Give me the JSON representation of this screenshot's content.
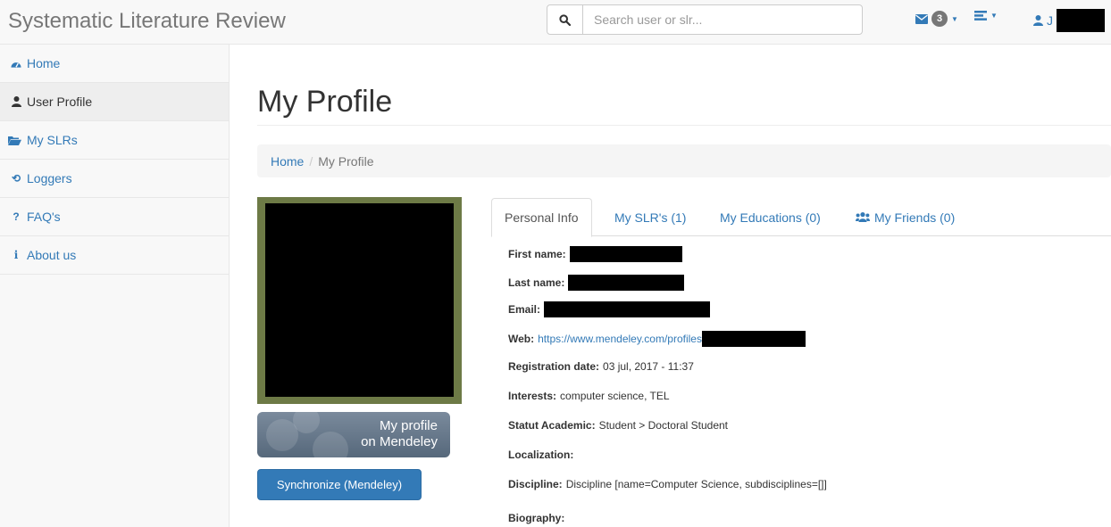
{
  "app": {
    "title": "Systematic Literature Review"
  },
  "search": {
    "placeholder": "Search user or slr..."
  },
  "navbar": {
    "messages_count": "3",
    "user_initial": "J",
    "icons": [
      "envelope-icon",
      "tasks-icon",
      "user-icon"
    ]
  },
  "sidebar": {
    "items": [
      {
        "label": "Home",
        "icon": "dashboard-icon",
        "active": false
      },
      {
        "label": "User Profile",
        "icon": "user-icon",
        "active": true
      },
      {
        "label": "My SLRs",
        "icon": "folder-open-icon",
        "active": false
      },
      {
        "label": "Loggers",
        "icon": "history-icon",
        "active": false
      },
      {
        "label": "FAQ's",
        "icon": "question-icon",
        "active": false
      },
      {
        "label": "About us",
        "icon": "info-icon",
        "active": false
      }
    ]
  },
  "page": {
    "title": "My Profile"
  },
  "breadcrumb": {
    "home": "Home",
    "separator": "/",
    "current": "My Profile"
  },
  "profile": {
    "mendeley_line1": "My profile",
    "mendeley_line2": "on Mendeley",
    "sync_label": "Synchronize (Mendeley)"
  },
  "tabs": [
    {
      "label": "Personal Info",
      "active": true
    },
    {
      "label": "My SLR's (1)",
      "active": false
    },
    {
      "label": "My Educations (0)",
      "active": false
    },
    {
      "label": "My Friends (0)",
      "active": false,
      "icon": "users-icon"
    }
  ],
  "info": {
    "first_name_label": "First name:",
    "last_name_label": "Last name:",
    "email_label": "Email:",
    "web_label": "Web:",
    "web_value": "https://www.mendeley.com/profiles",
    "registration_label": "Registration date:",
    "registration_value": "03 jul, 2017 - 11:37",
    "interests_label": "Interests:",
    "interests_value": "computer science, TEL",
    "statut_label": "Statut Academic:",
    "statut_value": "Student > Doctoral Student",
    "localization_label": "Localization:",
    "discipline_label": "Discipline:",
    "discipline_value": "Discipline [name=Computer Science, subdisciplines=[]]",
    "biography_label": "Biography:"
  },
  "colors": {
    "link": "#337ab7",
    "navbar_bg": "#f8f8f8",
    "button_primary": "#337ab7"
  }
}
